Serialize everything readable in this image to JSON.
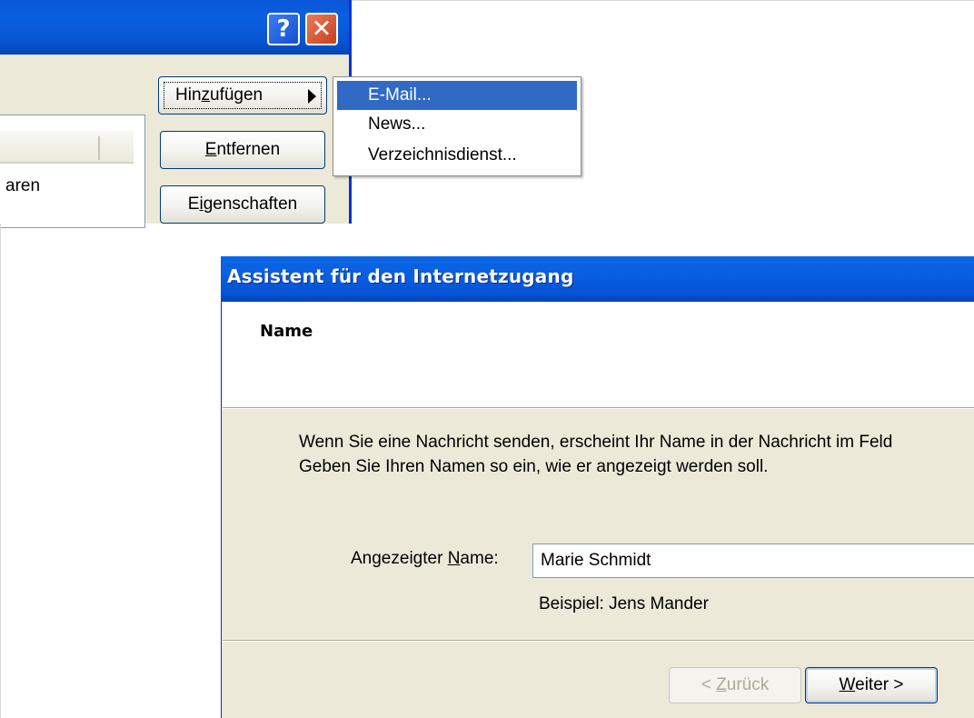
{
  "back_window": {
    "help_label": "?",
    "close_label": "✕",
    "list_row_text": "aren",
    "add_button": {
      "prefix": "Hin",
      "mnemonic": "z",
      "suffix": "ufügen"
    },
    "remove_button": {
      "mnemonic": "E",
      "suffix": "ntfernen"
    },
    "properties_button": {
      "prefix": "E",
      "mnemonic": "i",
      "suffix": "genschaften"
    }
  },
  "popup_menu": {
    "items": [
      {
        "label": "E-Mail..."
      },
      {
        "label": "News..."
      },
      {
        "label": "Verzeichnisdienst..."
      }
    ],
    "selected_index": 0
  },
  "wizard": {
    "title": "Assistent für den Internetzugang",
    "heading": "Name",
    "description_line1": "Wenn Sie eine Nachricht senden, erscheint Ihr Name in der Nachricht im Feld",
    "description_line2": "Geben Sie Ihren Namen so ein, wie er angezeigt werden soll.",
    "name_label": {
      "prefix": "Angezeigter ",
      "mnemonic": "N",
      "suffix": "ame:"
    },
    "name_value": "Marie Schmidt",
    "example": "Beispiel: Jens Mander",
    "back_button": {
      "prefix": "< ",
      "mnemonic": "Z",
      "suffix": "urück"
    },
    "next_button": {
      "mnemonic": "W",
      "suffix": "eiter >"
    }
  }
}
